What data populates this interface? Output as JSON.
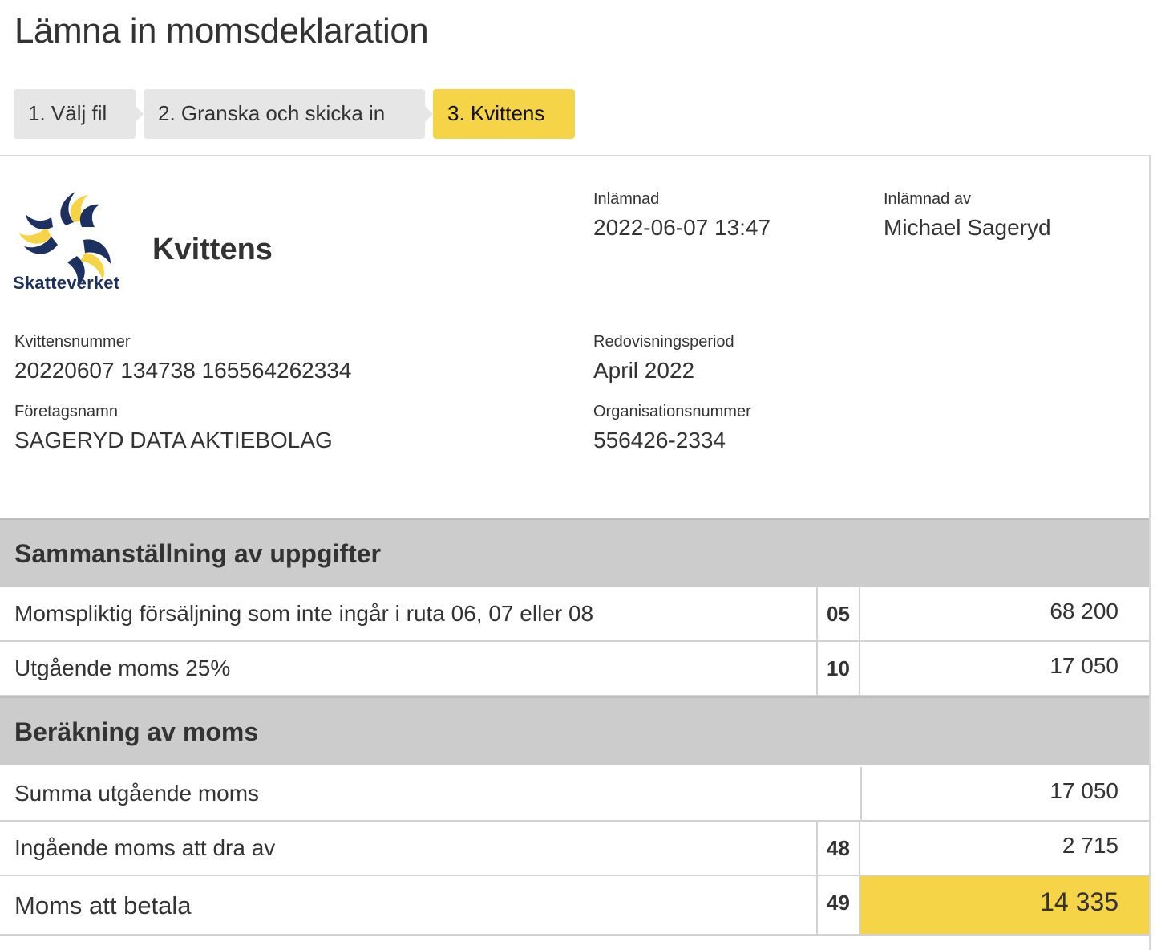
{
  "page": {
    "title": "Lämna in momsdeklaration"
  },
  "steps": [
    {
      "label": "1. Välj fil",
      "state": "inactive"
    },
    {
      "label": "2. Granska och skicka in",
      "state": "inactive"
    },
    {
      "label": "3. Kvittens",
      "state": "active"
    }
  ],
  "receipt": {
    "logo_text": "Skatteverket",
    "title": "Kvittens",
    "submitted_label": "Inlämnad",
    "submitted_value": "2022-06-07 13:47",
    "submitted_by_label": "Inlämnad av",
    "submitted_by_value": "Michael Sageryd",
    "receipt_number_label": "Kvittensnummer",
    "receipt_number_value": "20220607 134738 165564262334",
    "period_label": "Redovisningsperiod",
    "period_value": "April 2022",
    "company_label": "Företagsnamn",
    "company_value": "SAGERYD DATA AKTIEBOLAG",
    "org_number_label": "Organisationsnummer",
    "org_number_value": "556426-2334"
  },
  "summary": {
    "heading": "Sammanställning av uppgifter",
    "rows": [
      {
        "description": "Momspliktig försäljning som inte ingår i ruta 06, 07 eller 08",
        "code": "05",
        "amount": "68 200"
      },
      {
        "description": "Utgående moms 25%",
        "code": "10",
        "amount": "17 050"
      }
    ]
  },
  "calculation": {
    "heading": "Beräkning av moms",
    "rows": [
      {
        "description": "Summa utgående moms",
        "code": "",
        "amount": "17 050"
      },
      {
        "description": "Ingående moms att dra av",
        "code": "48",
        "amount": "2 715"
      },
      {
        "description": "Moms att betala",
        "code": "49",
        "amount": "14 335"
      }
    ]
  },
  "colors": {
    "accent_yellow": "#f5d547",
    "logo_navy": "#1d3161",
    "section_gray": "#cccccc",
    "step_gray": "#e6e6e6"
  }
}
